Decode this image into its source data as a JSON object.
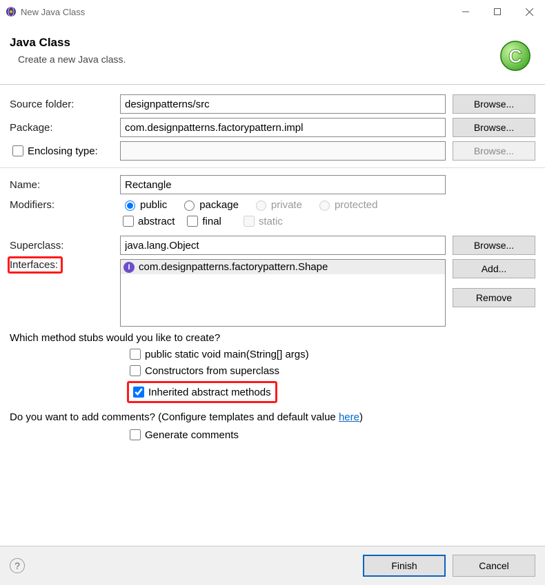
{
  "window": {
    "title": "New Java Class"
  },
  "header": {
    "title": "Java Class",
    "subtitle": "Create a new Java class."
  },
  "labels": {
    "source_folder": "Source folder:",
    "package": "Package:",
    "enclosing_type": "Enclosing type:",
    "name": "Name:",
    "modifiers": "Modifiers:",
    "superclass": "Superclass:",
    "interfaces": "Interfaces:"
  },
  "fields": {
    "source_folder": "designpatterns/src",
    "package": "com.designpatterns.factorypattern.impl",
    "enclosing_type": "",
    "name": "Rectangle",
    "superclass": "java.lang.Object"
  },
  "buttons": {
    "browse": "Browse...",
    "add": "Add...",
    "remove": "Remove",
    "finish": "Finish",
    "cancel": "Cancel"
  },
  "modifiers": {
    "access": {
      "public": "public",
      "package": "package",
      "private": "private",
      "protected": "protected"
    },
    "checks": {
      "abstract": "abstract",
      "final": "final",
      "static": "static"
    }
  },
  "interfaces": {
    "items": [
      {
        "text": "com.designpatterns.factorypattern.Shape"
      }
    ]
  },
  "stubs": {
    "question": "Which method stubs would you like to create?",
    "main": "public static void main(String[] args)",
    "constructors": "Constructors from superclass",
    "inherited": "Inherited abstract methods"
  },
  "comments": {
    "question_prefix": "Do you want to add comments? (Configure templates and default value ",
    "link_text": "here",
    "question_suffix": ")",
    "generate": "Generate comments"
  },
  "help": "?"
}
